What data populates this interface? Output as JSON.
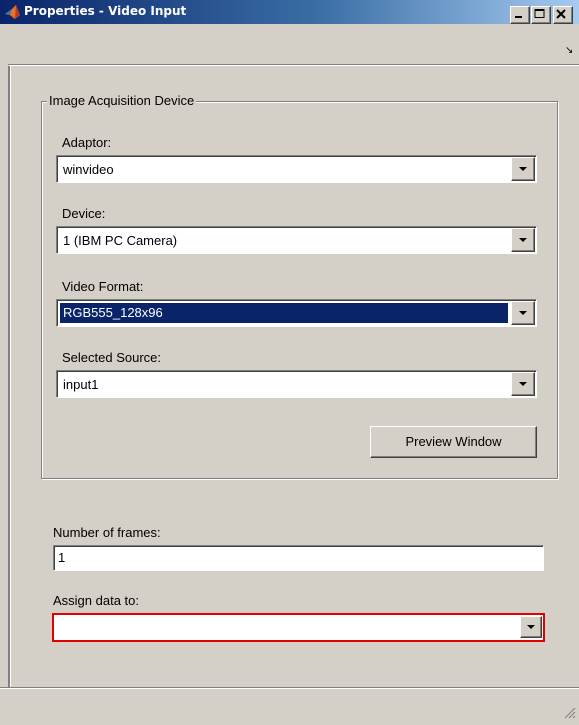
{
  "window": {
    "title": "Properties - Video Input",
    "title_icon": "matlab-logo-icon"
  },
  "group": {
    "legend": "Image Acquisition Device",
    "adaptor_label": "Adaptor:",
    "adaptor_value": "winvideo",
    "device_label": "Device:",
    "device_value": "1 (IBM PC Camera)",
    "format_label": "Video Format:",
    "format_value": "RGB555_128x96",
    "source_label": "Selected Source:",
    "source_value": "input1",
    "preview_button": "Preview Window"
  },
  "frames": {
    "label": "Number of frames:",
    "value": "1"
  },
  "assign": {
    "label": "Assign data to:",
    "value": ""
  },
  "colors": {
    "selection": "#0a246a",
    "error_border": "#e00000",
    "face": "#d4d0c8"
  }
}
